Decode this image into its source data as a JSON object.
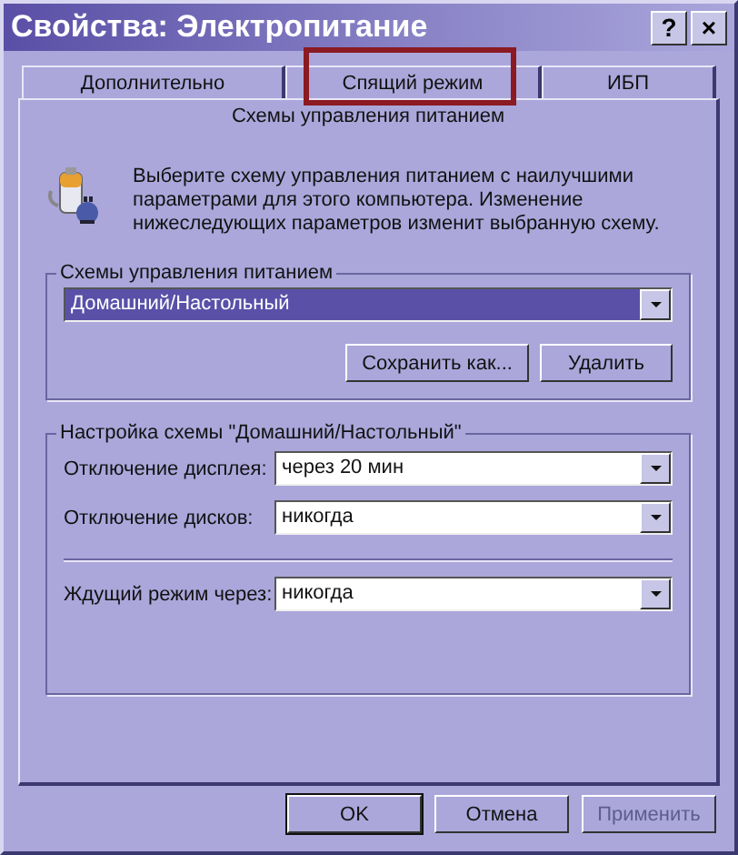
{
  "window": {
    "title": "Свойства: Электропитание",
    "title_buttons": [
      "?",
      "×"
    ]
  },
  "tabs": [
    {
      "label": "Дополнительно",
      "selected": false,
      "annotated": false
    },
    {
      "label": "Спящий режим",
      "selected": false,
      "annotated": true
    },
    {
      "label": "ИБП",
      "selected": false,
      "annotated": false
    },
    {
      "label": "Схемы управления питанием",
      "selected": true,
      "annotated": false
    }
  ],
  "description": "Выберите схему управления питанием с наилучшими параметрами для этого компьютера. Изменение нижеследующих параметров изменит выбранную схему.",
  "schemes_group": {
    "legend": "Схемы управления питанием",
    "dropdown": {
      "value": "Домашний/Настольный",
      "focused": true
    },
    "buttons": [
      {
        "label": "Сохранить как..."
      },
      {
        "label": "Удалить"
      }
    ]
  },
  "settings_group": {
    "legend": "Настройка схемы \"Домашний/Настольный\"",
    "rows": [
      {
        "label": "Отключение дисплея:",
        "value": "через 20 мин"
      },
      {
        "label": "Отключение дисков:",
        "value": "никогда"
      }
    ],
    "standby": {
      "label": "Ждущий режим через:",
      "value": "никогда"
    }
  },
  "buttons": [
    {
      "label": "OK",
      "default": true,
      "disabled": false
    },
    {
      "label": "Отмена",
      "default": false,
      "disabled": false
    },
    {
      "label": "Применить",
      "default": false,
      "disabled": true
    }
  ]
}
